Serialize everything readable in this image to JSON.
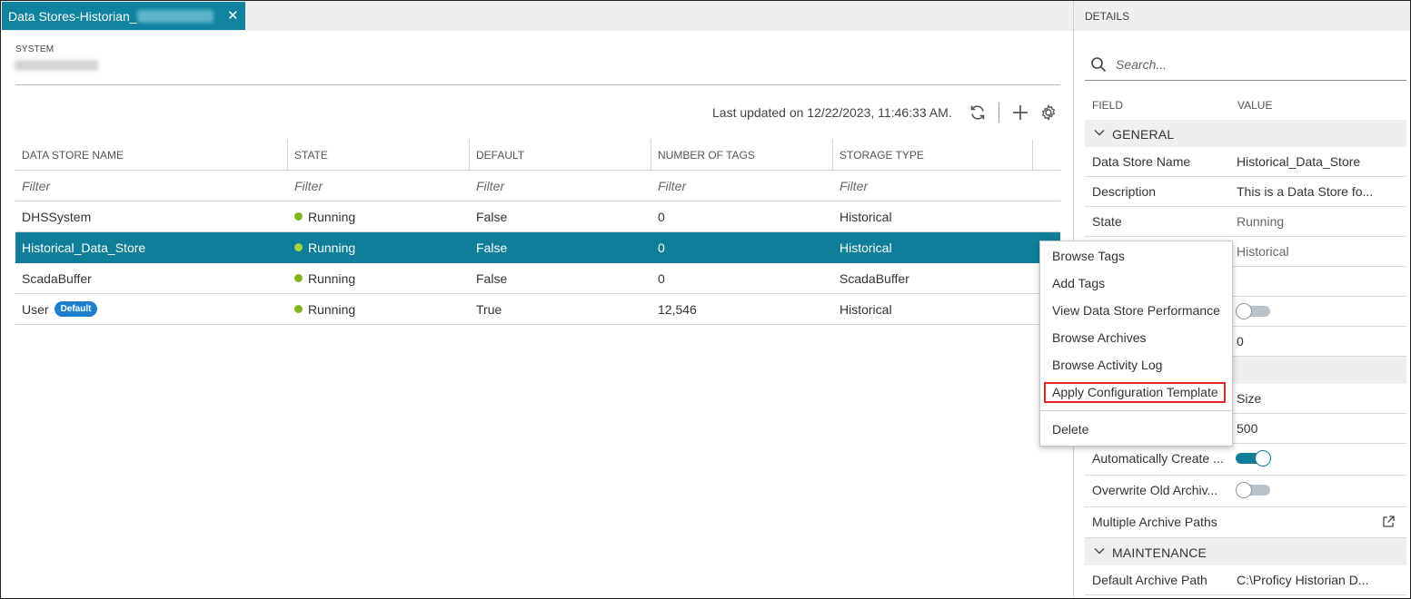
{
  "tab": {
    "title": "Data Stores-Historian_",
    "close_icon": "close-icon"
  },
  "system": {
    "label": "SYSTEM"
  },
  "toolbar": {
    "last_updated": "Last updated on 12/22/2023, 11:46:33 AM.",
    "icons": [
      "refresh-icon",
      "add-icon",
      "gear-icon"
    ]
  },
  "table": {
    "columns": [
      "DATA STORE NAME",
      "STATE",
      "DEFAULT",
      "NUMBER OF TAGS",
      "STORAGE TYPE"
    ],
    "filter_placeholder": "Filter",
    "rows": [
      {
        "name": "DHSSystem",
        "state": "Running",
        "default": "False",
        "tags": "0",
        "storage": "Historical"
      },
      {
        "name": "Historical_Data_Store",
        "state": "Running",
        "default": "False",
        "tags": "0",
        "storage": "Historical",
        "selected": true
      },
      {
        "name": "ScadaBuffer",
        "state": "Running",
        "default": "False",
        "tags": "0",
        "storage": "ScadaBuffer"
      },
      {
        "name": "User",
        "badge": "Default",
        "state": "Running",
        "default": "True",
        "tags": "12,546",
        "storage": "Historical"
      }
    ],
    "status_color": "#7fb51e",
    "selection_color": "#0f7f99"
  },
  "details": {
    "title": "DETAILS",
    "search_placeholder": "Search...",
    "col_field": "FIELD",
    "col_value": "VALUE",
    "sections": {
      "general": "GENERAL",
      "maintenance": "MAINTENANCE"
    },
    "rows": {
      "data_store_name": {
        "field": "Data Store Name",
        "value": "Historical_Data_Store"
      },
      "description": {
        "field": "Description",
        "value": "This is a Data Store fo..."
      },
      "state": {
        "field": "State",
        "value": "Running"
      },
      "storage_type": {
        "value": "Historical"
      },
      "zero": {
        "value": "0"
      },
      "archive_type": {
        "value": "Size"
      },
      "archive_size": {
        "value": "500"
      },
      "auto_create": {
        "field": "Automatically Create ..."
      },
      "overwrite": {
        "field": "Overwrite Old Archiv..."
      },
      "multi_paths": {
        "field": "Multiple Archive Paths"
      },
      "default_path": {
        "field": "Default Archive Path",
        "value": "C:\\Proficy Historian D..."
      }
    },
    "toggles": {
      "toggle_1": false,
      "auto_create": true,
      "overwrite": false
    }
  },
  "context_menu": {
    "items": [
      "Browse Tags",
      "Add Tags",
      "View Data Store Performance",
      "Browse Archives",
      "Browse Activity Log",
      "Apply Configuration Template",
      "Delete"
    ],
    "highlight_color": "#e0242b"
  }
}
